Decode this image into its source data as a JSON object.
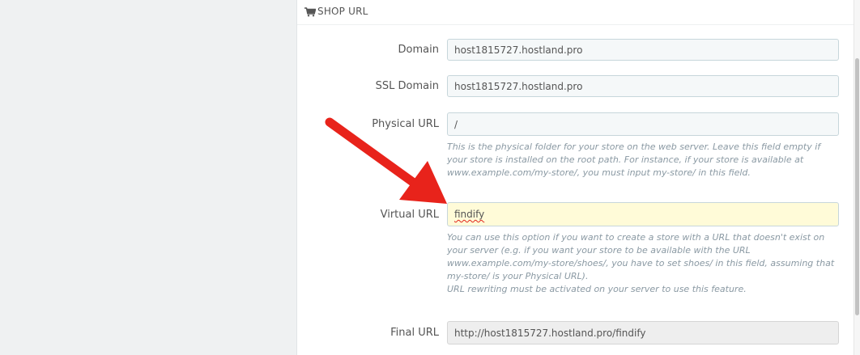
{
  "section": {
    "title": "SHOP URL",
    "icon": "shopping-cart-icon"
  },
  "fields": {
    "domain": {
      "label": "Domain",
      "value": "host1815727.hostland.pro"
    },
    "ssl_domain": {
      "label": "SSL Domain",
      "value": "host1815727.hostland.pro"
    },
    "physical_url": {
      "label": "Physical URL",
      "value": "/",
      "help": "This is the physical folder for your store on the web server. Leave this field empty if your store is installed on the root path. For instance, if your store is available at www.example.com/my-store/, you must input my-store/ in this field."
    },
    "virtual_url": {
      "label": "Virtual URL",
      "value": "findify",
      "help_line1": "You can use this option if you want to create a store with a URL that doesn't exist on your server (e.g. if you want your store to be available with the URL www.example.com/my-store/shoes/, you have to set shoes/ in this field, assuming that my-store/ is your Physical URL).",
      "help_line2": "URL rewriting must be activated on your server to use this feature."
    },
    "final_url": {
      "label": "Final URL",
      "value": "http://host1815727.hostland.pro/findify"
    }
  },
  "colors": {
    "arrow": "#e8231b",
    "focused_field_bg": "#fffbd8",
    "help_text": "#8a99a3"
  }
}
